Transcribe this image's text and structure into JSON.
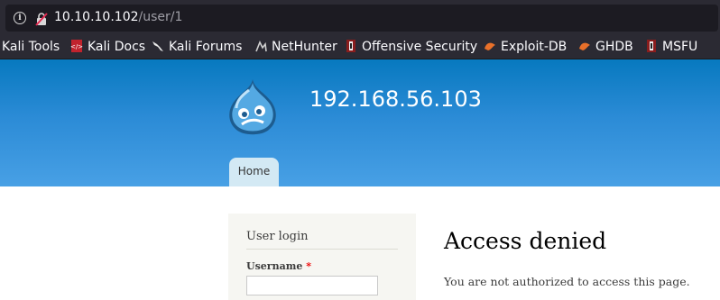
{
  "browser": {
    "url_host": "10.10.10.102",
    "url_path": "/user/1",
    "bookmarks": [
      {
        "label": "Kali Tools",
        "icon": "kali-tools-icon"
      },
      {
        "label": "Kali Docs",
        "icon": "kali-docs-icon"
      },
      {
        "label": "Kali Forums",
        "icon": "kali-dragon-icon"
      },
      {
        "label": "NetHunter",
        "icon": "nethunter-icon"
      },
      {
        "label": "Offensive Security",
        "icon": "offsec-icon"
      },
      {
        "label": "Exploit-DB",
        "icon": "exploitdb-icon"
      },
      {
        "label": "GHDB",
        "icon": "ghdb-icon"
      },
      {
        "label": "MSFU",
        "icon": "msfu-icon"
      }
    ]
  },
  "site": {
    "name": "192.168.56.103",
    "nav": {
      "home": "Home"
    }
  },
  "login_block": {
    "title": "User login",
    "username_label": "Username",
    "required_marker": "*",
    "username_value": ""
  },
  "main": {
    "title": "Access denied",
    "message": "You are not authorized to access this page."
  },
  "colors": {
    "header_top": "#0779bf",
    "header_bottom": "#48a0e5",
    "tab_active": "#d3e9f4",
    "sidebar_bg": "#f6f6f2"
  }
}
